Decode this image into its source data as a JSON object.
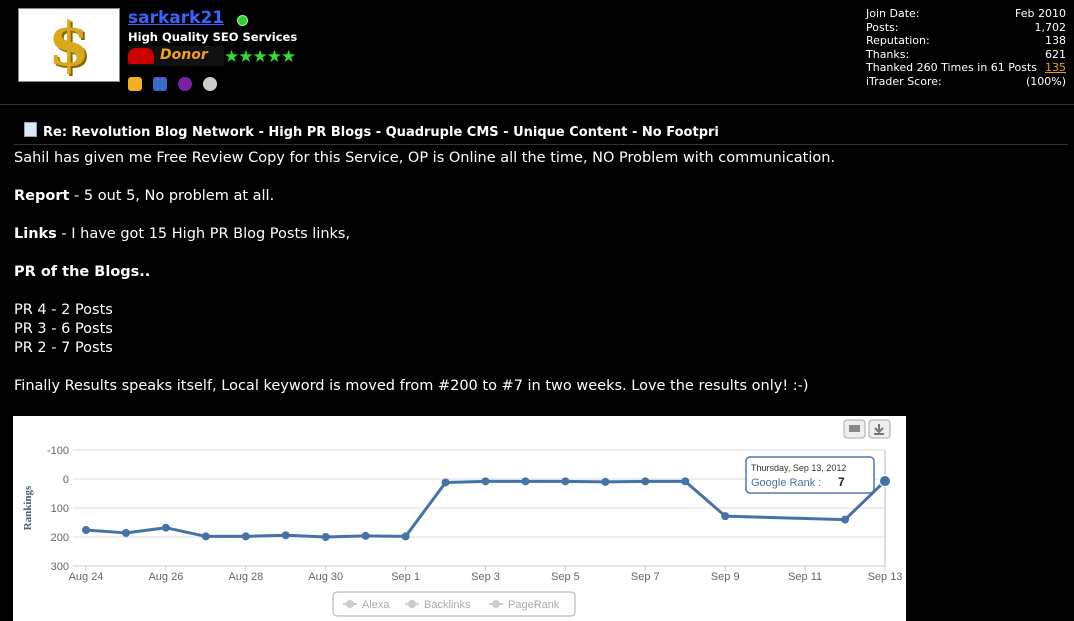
{
  "user": {
    "username": "sarkark21",
    "title": "High Quality SEO Services",
    "badge": "Donor",
    "stars": "★★★★★",
    "avatar_symbol": "$"
  },
  "stats": [
    {
      "label": "Join Date:",
      "value": "Feb 2010"
    },
    {
      "label": "Posts:",
      "value": "1,702"
    },
    {
      "label": "Reputation:",
      "value": "138"
    },
    {
      "label": "Thanks:",
      "value": "621"
    },
    {
      "label": "Thanked 260 Times in 61 Posts",
      "value": "135"
    },
    {
      "label": "iTrader Score:",
      "value": "(100%)"
    }
  ],
  "post": {
    "title": "Re: Revolution Blog Network - High PR Blogs - Quadruple CMS - Unique Content - No Footpri",
    "line1": "Sahil has given me Free Review Copy for this Service, OP is Online all the time, NO Problem with communication.",
    "report_label": "Report",
    "report_text": " - 5 out 5, No problem at all.",
    "links_label": "Links",
    "links_text": " - I have got 15 High PR Blog Posts links,",
    "pr_heading": "PR of the Blogs..",
    "pr4": "PR 4 - 2 Posts",
    "pr3": "PR 3 - 6 Posts",
    "pr2": "PR 2 - 7 Posts",
    "final": "Finally Results speaks itself, Local keyword is moved from #200 to #7 in two weeks. Love the results only! :-)"
  },
  "chart_data": {
    "type": "line",
    "ylabel": "Rankings",
    "y_ticks": [
      -100,
      0,
      100,
      200,
      300
    ],
    "ylim": [
      -100,
      300
    ],
    "y_reversed": true,
    "x_ticks": [
      "Aug 24",
      "Aug 26",
      "Aug 28",
      "Aug 30",
      "Sep 1",
      "Sep 3",
      "Sep 5",
      "Sep 7",
      "Sep 9",
      "Sep 11",
      "Sep 13"
    ],
    "x": [
      "Aug 24",
      "Aug 25",
      "Aug 26",
      "Aug 27",
      "Aug 28",
      "Aug 29",
      "Aug 30",
      "Aug 31",
      "Sep 1",
      "Sep 2",
      "Sep 3",
      "Sep 4",
      "Sep 5",
      "Sep 6",
      "Sep 7",
      "Sep 8",
      "Sep 9",
      "Sep 10",
      "Sep 11",
      "Sep 12",
      "Sep 13"
    ],
    "series": [
      {
        "name": "Google Rank",
        "color": "#4572a7",
        "values": [
          176,
          186,
          168,
          198,
          198,
          194,
          200,
          196,
          198,
          12,
          8,
          8,
          8,
          10,
          8,
          8,
          128,
          null,
          null,
          140,
          7
        ]
      }
    ],
    "tooltip": {
      "date": "Thursday, Sep 13, 2012",
      "label": "Google Rank :",
      "value": "7"
    },
    "legend": [
      "Alexa",
      "Backlinks",
      "PageRank"
    ],
    "legend_position": "bottom-center",
    "grid": true
  }
}
